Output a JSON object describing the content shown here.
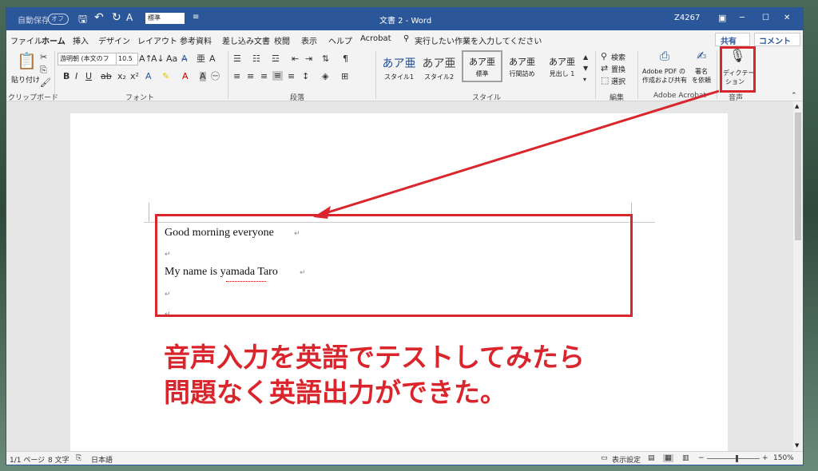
{
  "titlebar": {
    "autosave_label": "自動保存",
    "autosave_state": "オフ",
    "style_box": "標準",
    "doc_title": "文書 2 - Word",
    "user": "Z4267",
    "minimize": "─",
    "restore": "☐",
    "close": "✕"
  },
  "tabs": [
    "ファイル",
    "ホーム",
    "挿入",
    "デザイン",
    "レイアウト",
    "参考資料",
    "差し込み文書",
    "校閲",
    "表示",
    "ヘルプ",
    "Acrobat"
  ],
  "tell_me": "実行したい作業を入力してください",
  "share": "共有",
  "comment": "コメント",
  "ribbon": {
    "paste": "貼り付け",
    "clipboard": "クリップボード",
    "font_name": "游明朝 (本文のフ",
    "font_size": "10.5",
    "font_group": "フォント",
    "paragraph_group": "段落",
    "styles": [
      {
        "sample": "あア亜",
        "name": "スタイル1"
      },
      {
        "sample": "あア亜",
        "name": "スタイル2"
      },
      {
        "sample": "あア亜",
        "name": "標準"
      },
      {
        "sample": "あア亜",
        "name": "行間詰め"
      },
      {
        "sample": "あア亜",
        "name": "見出し 1"
      }
    ],
    "styles_group": "スタイル",
    "find": "検索",
    "replace": "置換",
    "select": "選択",
    "editing_group": "編集",
    "acrobat_create": "Adobe PDF の",
    "acrobat_create2": "作成および共有",
    "acrobat_sign": "署名",
    "acrobat_sign2": "を依頼",
    "acrobat_group": "Adobe Acrobat",
    "dictate": "ディクテー",
    "dictate2": "ション",
    "voice_group": "音声"
  },
  "document": {
    "line1": "Good morning everyone",
    "line2": "My name is yamada Taro",
    "para_mark": "↵"
  },
  "annotation": {
    "line1": "音声入力を英語でテストしてみたら",
    "line2": "問題なく英語出力ができた。"
  },
  "statusbar": {
    "page": "1/1 ページ",
    "words": "8 文字",
    "language": "日本語",
    "display_settings": "表示設定",
    "zoom": "150%"
  },
  "colors": {
    "accent": "#2b579a",
    "highlight": "#d9252b"
  }
}
